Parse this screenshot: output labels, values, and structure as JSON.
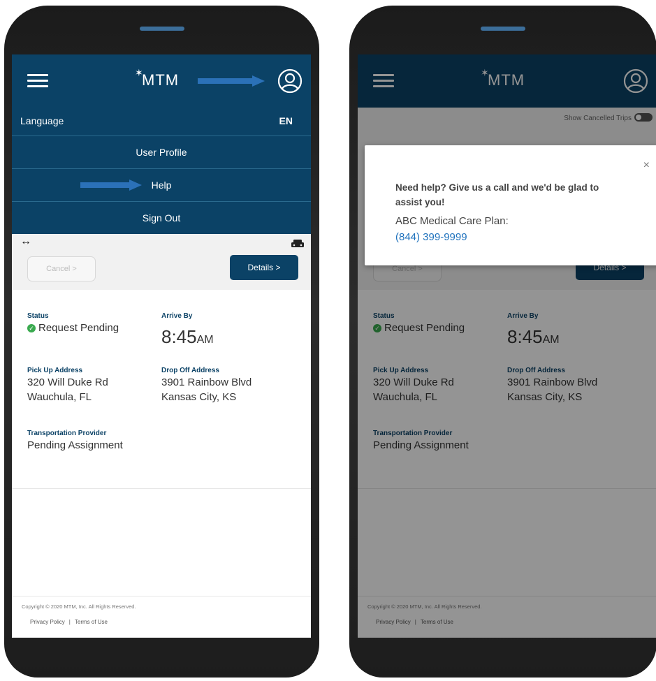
{
  "header": {
    "logo": "MTM",
    "logo_mark": "✶"
  },
  "menu": {
    "language_label": "Language",
    "language_value": "EN",
    "items": [
      "User Profile",
      "Help",
      "Sign Out"
    ]
  },
  "trip": {
    "cancel_label": "Cancel >",
    "details_label": "Details >",
    "status_label": "Status",
    "status_value": "Request Pending",
    "arrive_label": "Arrive By",
    "arrive_time": "8:45",
    "arrive_ampm": "AM",
    "pickup_label": "Pick Up Address",
    "pickup_line1": "320 Will Duke Rd",
    "pickup_line2": "Wauchula, FL",
    "dropoff_label": "Drop Off Address",
    "dropoff_line1": "3901 Rainbow Blvd",
    "dropoff_line2": "Kansas City, KS",
    "provider_label": "Transportation Provider",
    "provider_value": "Pending Assignment"
  },
  "footer": {
    "copyright": "Copyright © 2020 MTM, Inc. All Rights Reserved.",
    "privacy": "Privacy Policy",
    "terms": "Terms of Use"
  },
  "right_screen": {
    "show_cancelled": "Show Cancelled Trips",
    "modal": {
      "text": "Need help? Give us a call and we'd be glad to assist you!",
      "plan": "ABC Medical Care Plan:",
      "phone": "(844) 399-9999",
      "close": "×"
    }
  },
  "colors": {
    "brand_navy": "#0b4266",
    "accent_blue": "#2b71b8",
    "status_green": "#3aaa4f",
    "link_blue": "#1f72bd"
  },
  "icons": [
    "hamburger-menu-icon",
    "user-profile-icon",
    "swap-arrows-icon",
    "car-icon",
    "check-circle-icon",
    "close-icon"
  ]
}
